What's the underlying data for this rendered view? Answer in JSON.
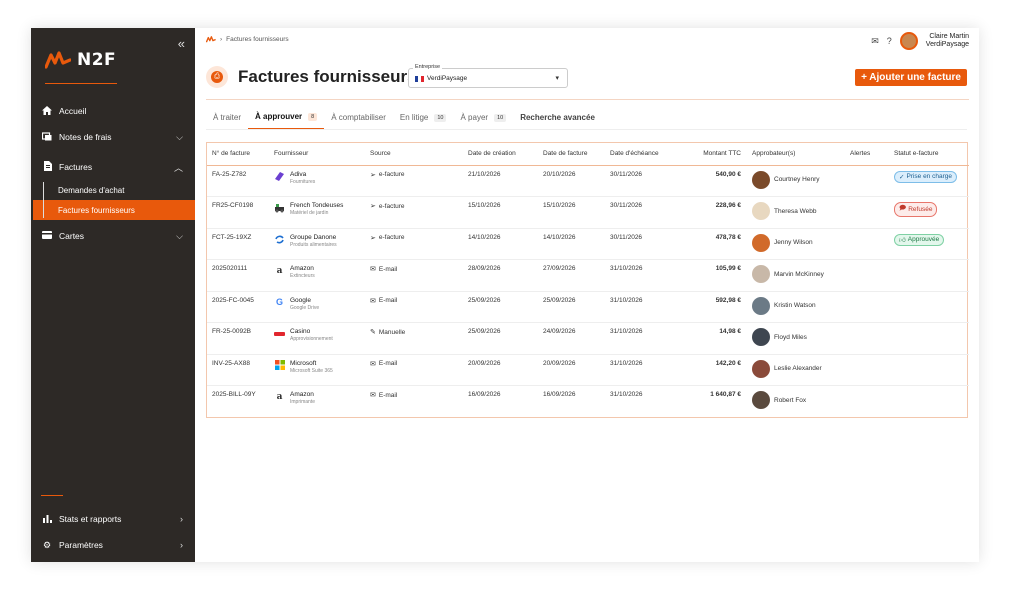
{
  "brand": {
    "name": "N2F",
    "accent": "#e8590c"
  },
  "sidebar": {
    "collapse_icon": "double-chevron-left-icon",
    "items": [
      {
        "label": "Accueil",
        "icon": "home-icon"
      },
      {
        "label": "Notes de frais",
        "icon": "receipt-icon"
      },
      {
        "label": "Factures",
        "icon": "invoice-icon"
      },
      {
        "label": "Cartes",
        "icon": "card-icon"
      }
    ],
    "factures_sub": [
      {
        "label": "Demandes d'achat"
      },
      {
        "label": "Factures fournisseurs"
      }
    ],
    "bottom": [
      {
        "label": "Stats et rapports",
        "icon": "chart-icon"
      },
      {
        "label": "Paramètres",
        "icon": "gear-icon"
      }
    ]
  },
  "breadcrumb": {
    "current": "Factures fournisseurs"
  },
  "user": {
    "name": "Claire Martin",
    "company": "VerdiPaysage"
  },
  "header": {
    "title": "Factures fournisseurs",
    "entreprise_label": "Entreprise",
    "entreprise_value": "VerdiPaysage",
    "add_button": "+ Ajouter une facture"
  },
  "tabs": [
    {
      "label": "À traiter",
      "badge": ""
    },
    {
      "label": "À approuver",
      "badge": "8"
    },
    {
      "label": "À comptabiliser",
      "badge": ""
    },
    {
      "label": "En litige",
      "badge": "10"
    },
    {
      "label": "À payer",
      "badge": "10"
    },
    {
      "label": "Recherche avancée",
      "badge": ""
    }
  ],
  "table": {
    "headers": [
      "N° de facture",
      "Fournisseur",
      "Source",
      "Date de création",
      "Date de facture",
      "Date d'échéance",
      "Montant TTC",
      "Approbateur(s)",
      "Alertes",
      "Statut e-facture"
    ],
    "rows": [
      {
        "num": "FA-25-Z782",
        "supplier": "Adiva",
        "category": "Fournitures",
        "source": "e-facture",
        "created": "21/10/2026",
        "invoice_date": "20/10/2026",
        "due": "30/11/2026",
        "amount": "540,90 €",
        "approver": "Courtney Henry",
        "status": "Prise en charge"
      },
      {
        "num": "FR25-CF0198",
        "supplier": "French Tondeuses",
        "category": "Matériel de jardin",
        "source": "e-facture",
        "created": "15/10/2026",
        "invoice_date": "15/10/2026",
        "due": "30/11/2026",
        "amount": "228,96 €",
        "approver": "Theresa Webb",
        "status": "Refusée"
      },
      {
        "num": "FCT-25-19XZ",
        "supplier": "Groupe Danone",
        "category": "Produits alimentaires",
        "source": "e-facture",
        "created": "14/10/2026",
        "invoice_date": "14/10/2026",
        "due": "30/11/2026",
        "amount": "478,78 €",
        "approver": "Jenny Wilson",
        "status": "Approuvée"
      },
      {
        "num": "2025020111",
        "supplier": "Amazon",
        "category": "Extincteurs",
        "source": "E-mail",
        "created": "28/09/2026",
        "invoice_date": "27/09/2026",
        "due": "31/10/2026",
        "amount": "105,99 €",
        "approver": "Marvin McKinney",
        "status": ""
      },
      {
        "num": "2025-FC-0045",
        "supplier": "Google",
        "category": "Google Drive",
        "source": "E-mail",
        "created": "25/09/2026",
        "invoice_date": "25/09/2026",
        "due": "31/10/2026",
        "amount": "592,98 €",
        "approver": "Kristin Watson",
        "status": ""
      },
      {
        "num": "FR-25-0092B",
        "supplier": "Casino",
        "category": "Approvisionnement",
        "source": "Manuelle",
        "created": "25/09/2026",
        "invoice_date": "24/09/2026",
        "due": "31/10/2026",
        "amount": "14,98 €",
        "approver": "Floyd Miles",
        "status": ""
      },
      {
        "num": "INV-25-AX88",
        "supplier": "Microsoft",
        "category": "Microsoft Suite 365",
        "source": "E-mail",
        "created": "20/09/2026",
        "invoice_date": "20/09/2026",
        "due": "31/10/2026",
        "amount": "142,20 €",
        "approver": "Leslie Alexander",
        "status": ""
      },
      {
        "num": "2025-BILL-09Y",
        "supplier": "Amazon",
        "category": "Imprimante",
        "source": "E-mail",
        "created": "16/09/2026",
        "invoice_date": "16/09/2026",
        "due": "31/10/2026",
        "amount": "1 640,87 €",
        "approver": "Robert Fox",
        "status": ""
      }
    ]
  }
}
